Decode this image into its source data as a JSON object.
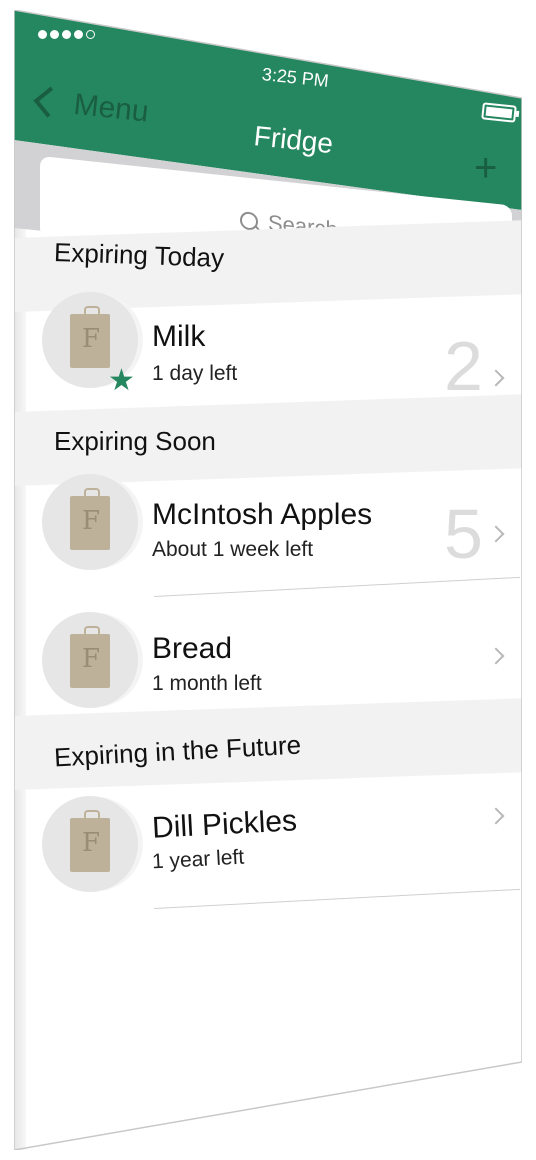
{
  "status": {
    "time": "3:25 PM",
    "signal_dots": [
      "full",
      "full",
      "full",
      "full",
      "empty"
    ]
  },
  "header": {
    "back_label": "Menu",
    "title": "Fridge",
    "add_icon": "plus-icon"
  },
  "search": {
    "placeholder": "Search"
  },
  "sections": [
    {
      "label": "Expiring Today",
      "items": [
        {
          "name": "Milk",
          "time_left": "1 day left",
          "count": "2",
          "starred": true
        }
      ]
    },
    {
      "label": "Expiring Soon",
      "items": [
        {
          "name": "McIntosh Apples",
          "time_left": "About 1 week left",
          "count": "5"
        },
        {
          "name": "Bread",
          "time_left": "1 month left",
          "count": ""
        }
      ]
    },
    {
      "label": "Expiring in the Future",
      "items": [
        {
          "name": "Dill Pickles",
          "time_left": "1 year left",
          "count": ""
        }
      ]
    }
  ],
  "colors": {
    "accent": "#24875f",
    "accent_dark": "#1a5e42",
    "bag": "#bdb19a"
  }
}
